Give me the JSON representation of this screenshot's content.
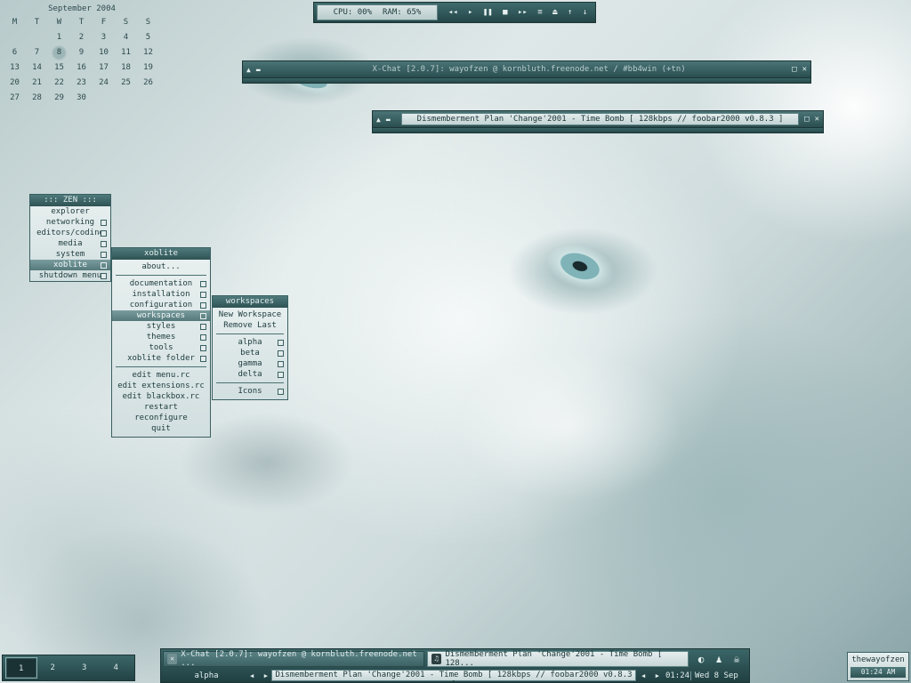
{
  "calendar": {
    "title": "September 2004",
    "weekdays": [
      "M",
      "T",
      "W",
      "T",
      "F",
      "S",
      "S"
    ],
    "weeks": [
      [
        "",
        "",
        "1",
        "2",
        "3",
        "4",
        "5"
      ],
      [
        "6",
        "7",
        "8",
        "9",
        "10",
        "11",
        "12"
      ],
      [
        "13",
        "14",
        "15",
        "16",
        "17",
        "18",
        "19"
      ],
      [
        "20",
        "21",
        "22",
        "23",
        "24",
        "25",
        "26"
      ],
      [
        "27",
        "28",
        "29",
        "30",
        "",
        "",
        ""
      ]
    ],
    "today": "8"
  },
  "sysbar": {
    "cpu": "CPU: 00%",
    "ram": "RAM: 65%",
    "controls": [
      "◂◂",
      "▸",
      "❚❚",
      "■",
      "▸▸",
      "≡",
      "⏏",
      "↑",
      "↓"
    ]
  },
  "xchat_window": {
    "title": "X-Chat [2.0.7]: wayofzen @ kornbluth.freenode.net / #bb4win (+tn)"
  },
  "foobar_window": {
    "title": "Dismemberment Plan 'Change'2001 - Time Bomb  [ 128kbps // foobar2000 v0.8.3 ]"
  },
  "zen_menu": {
    "title": "::: ZEN :::",
    "items": [
      "explorer",
      "networking",
      "editors/coding",
      "media",
      "system",
      "xoblite",
      "shutdown menu"
    ]
  },
  "xoblite_menu": {
    "title": "xoblite",
    "about": "about...",
    "group1": [
      "documentation",
      "installation",
      "configuration",
      "workspaces",
      "styles",
      "themes",
      "tools",
      "xoblite folder"
    ],
    "group2": [
      "edit menu.rc",
      "edit extensions.rc",
      "edit blackbox.rc",
      "restart",
      "reconfigure",
      "quit"
    ]
  },
  "workspaces_menu": {
    "title": "workspaces",
    "actions": [
      "New Workspace",
      "Remove Last"
    ],
    "workspaces": [
      "alpha",
      "beta",
      "gamma",
      "delta"
    ],
    "icons": "Icons"
  },
  "pager": {
    "desktops": [
      "1",
      "2",
      "3",
      "4"
    ],
    "active": "1"
  },
  "taskbar": {
    "tasks": [
      "X-Chat [2.0.7]: wayofzen @ kornbluth.freenode.net ...",
      "Dismemberment Plan 'Change'2001 - Time Bomb  [ 128..."
    ],
    "workspace": "alpha",
    "current_title": "Dismemberment Plan 'Change'2001 - Time Bomb  [ 128kbps // foobar2000 v0.8.3 ]",
    "clock": "01:24",
    "date": "Wed 8 Sep"
  },
  "userbox": {
    "name": "thewayofzen",
    "clock": "01:24 AM"
  }
}
